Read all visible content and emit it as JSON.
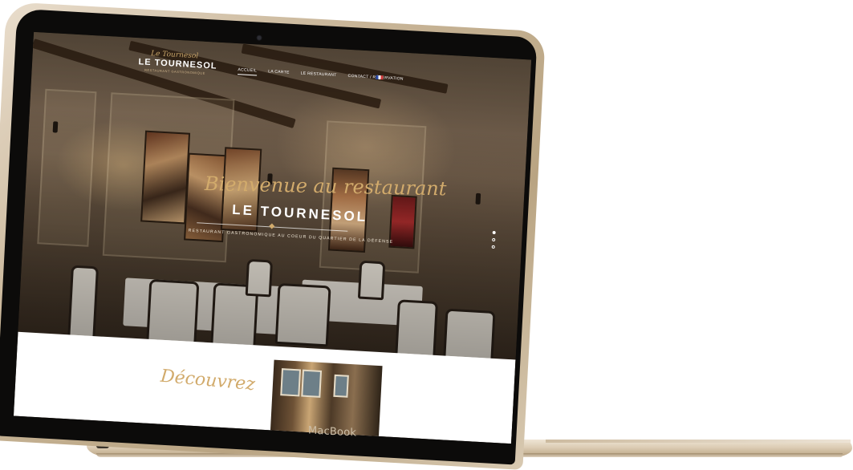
{
  "device": {
    "brand_label": "MacBook"
  },
  "site": {
    "logo": {
      "script": "Le Tournesol",
      "name": "LE TOURNESOL",
      "sub": "RESTAURANT GASTRONOMIQUE"
    },
    "nav": [
      {
        "label": "ACCUEIL",
        "active": true
      },
      {
        "label": "LA CARTE",
        "active": false
      },
      {
        "label": "LE RESTAURANT",
        "active": false
      },
      {
        "label": "CONTACT / RÉSERVATION",
        "active": false
      }
    ],
    "language_flag": "french-flag-icon",
    "hero": {
      "welcome": "Bienvenue au restaurant",
      "title": "LE TOURNESOL",
      "tagline": "RESTAURANT GASTRONOMIQUE AU COEUR DU QUARTIER DE LA DÉFENSE",
      "slides": 3,
      "active_slide": 1
    },
    "section": {
      "heading": "Découvrez"
    },
    "colors": {
      "accent_gold": "#d2ab6c",
      "text_white": "#ffffff"
    }
  }
}
